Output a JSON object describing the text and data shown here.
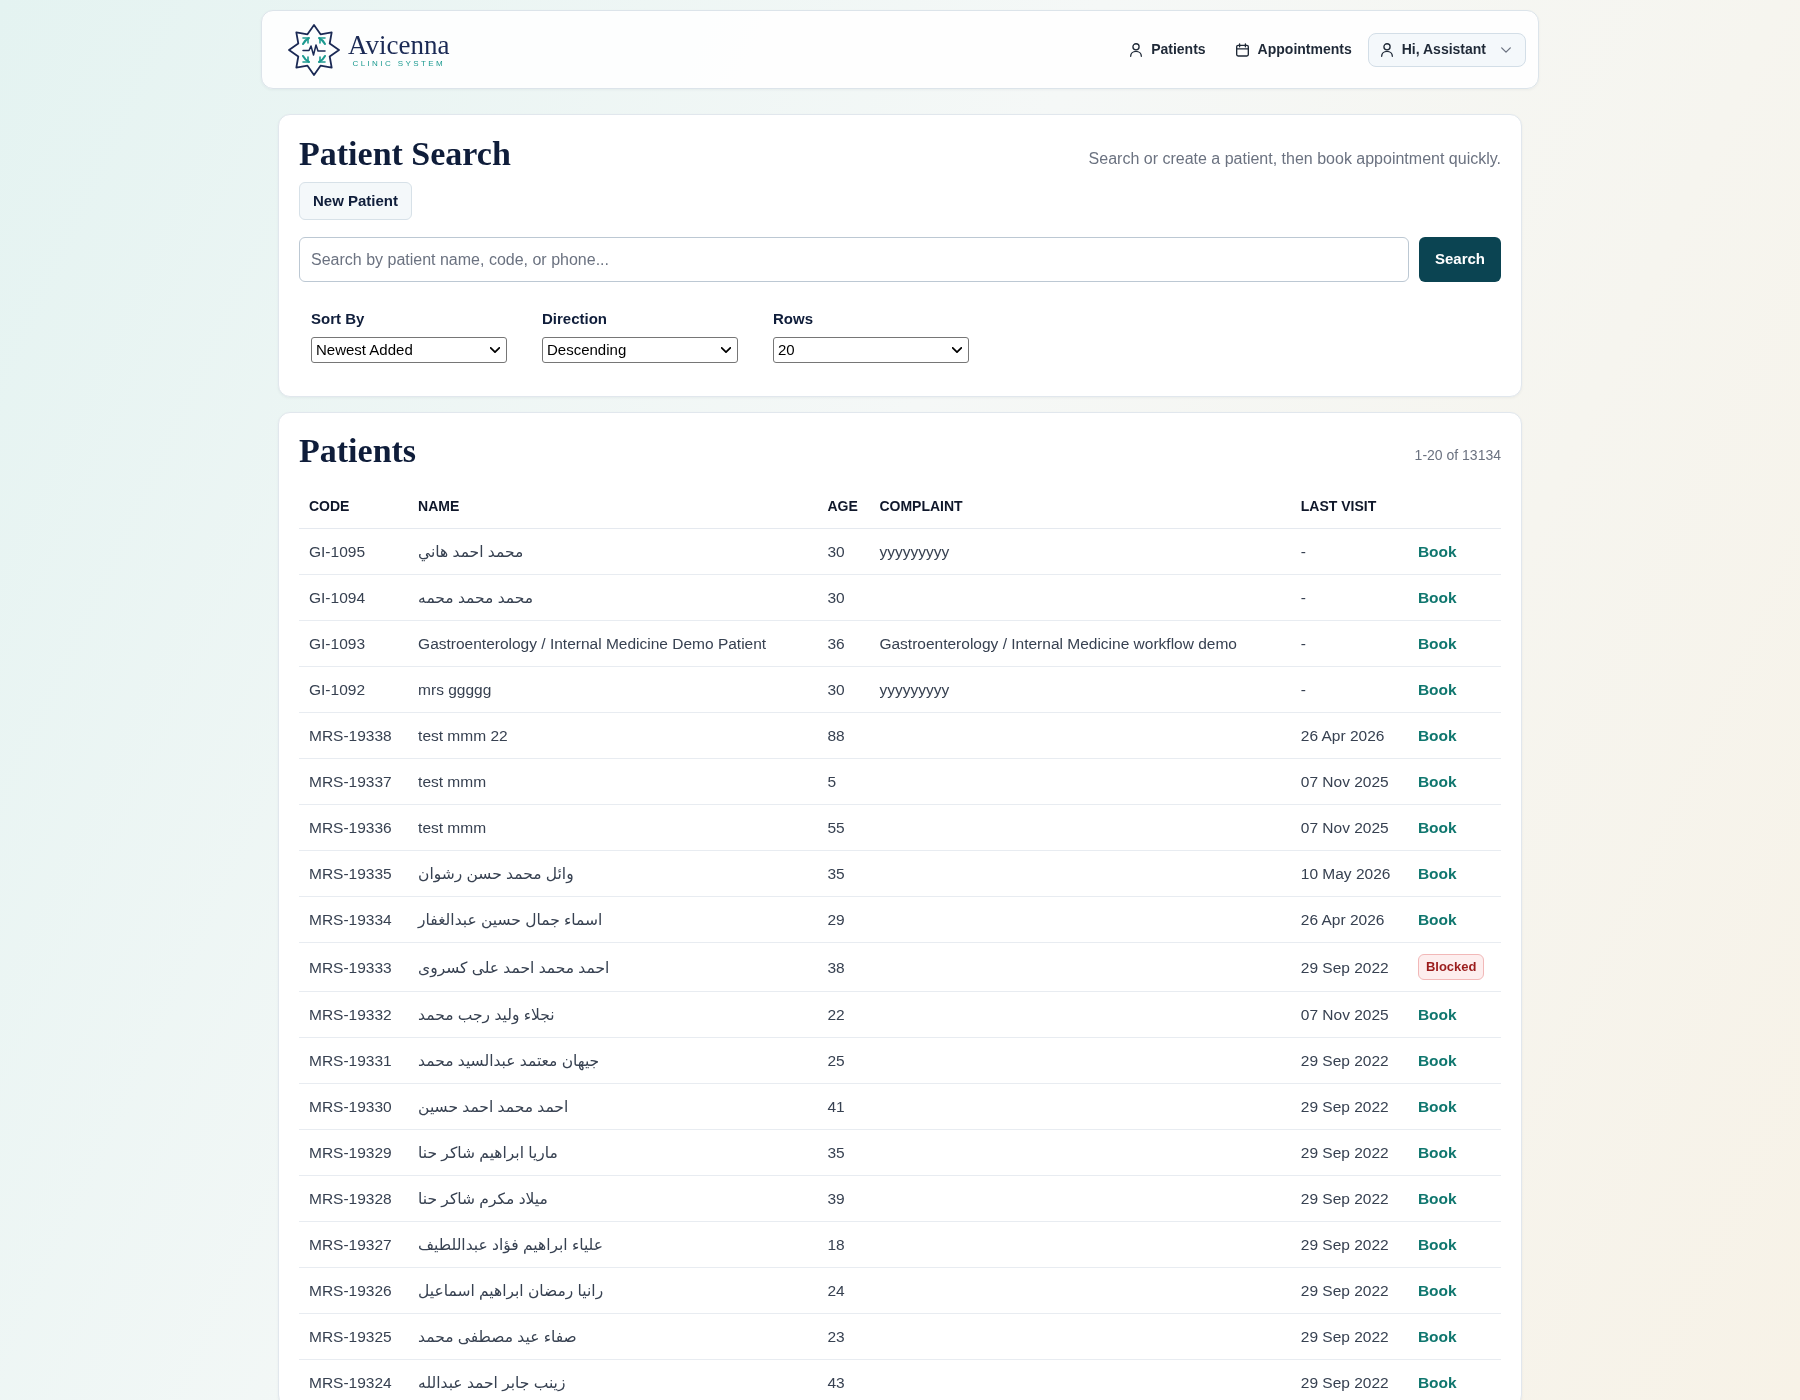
{
  "header": {
    "brand": {
      "name": "Avicenna",
      "tagline": "CLINIC SYSTEM"
    },
    "nav": [
      {
        "label": "Patients"
      },
      {
        "label": "Appointments"
      }
    ],
    "user_menu": {
      "label": "Hi, Assistant"
    }
  },
  "search_panel": {
    "title": "Patient Search",
    "subtitle": "Search or create a patient, then book appointment quickly.",
    "new_button": "New Patient",
    "search": {
      "placeholder": "Search by patient name, code, or phone..."
    },
    "search_button": "Search",
    "filters": [
      {
        "label": "Sort By",
        "value": "Newest Added"
      },
      {
        "label": "Direction",
        "value": "Descending"
      },
      {
        "label": "Rows",
        "value": "20"
      }
    ]
  },
  "patients": {
    "title": "Patients",
    "count": "1-20 of 13134",
    "table": {
      "columns": [
        "CODE",
        "NAME",
        "AGE",
        "COMPLAINT",
        "LAST VISIT"
      ],
      "rows": [
        {
          "code": "GI-1095",
          "name": "محمد احمد هاني",
          "age": "30",
          "complaint": "yyyyyyyyy",
          "last_visit": "-",
          "action": {
            "kind": "book",
            "label": "Book"
          }
        },
        {
          "code": "GI-1094",
          "name": "محمد محمد محمه",
          "age": "30",
          "last_visit": "-",
          "action": {
            "kind": "book",
            "label": "Book"
          }
        },
        {
          "code": "GI-1093",
          "name": "Gastroenterology / Internal Medicine Demo Patient",
          "age": "36",
          "complaint": "Gastroenterology / Internal Medicine workflow demo",
          "last_visit": "-",
          "action": {
            "kind": "book",
            "label": "Book"
          }
        },
        {
          "code": "GI-1092",
          "name": "mrs ggggg",
          "age": "30",
          "complaint": "yyyyyyyyy",
          "last_visit": "-",
          "action": {
            "kind": "book",
            "label": "Book"
          }
        },
        {
          "code": "MRS-19338",
          "name": "test mmm 22",
          "age": "88",
          "last_visit": "26 Apr 2026",
          "action": {
            "kind": "book",
            "label": "Book"
          }
        },
        {
          "code": "MRS-19337",
          "name": "test mmm",
          "age": "5",
          "last_visit": "07 Nov 2025",
          "action": {
            "kind": "book",
            "label": "Book"
          }
        },
        {
          "code": "MRS-19336",
          "name": "test mmm",
          "age": "55",
          "last_visit": "07 Nov 2025",
          "action": {
            "kind": "book",
            "label": "Book"
          }
        },
        {
          "code": "MRS-19335",
          "name": "وائل محمد حسن رشوان",
          "age": "35",
          "last_visit": "10 May 2026",
          "action": {
            "kind": "book",
            "label": "Book"
          }
        },
        {
          "code": "MRS-19334",
          "name": "اسماء جمال حسين عبدالغفار",
          "age": "29",
          "last_visit": "26 Apr 2026",
          "action": {
            "kind": "book",
            "label": "Book"
          }
        },
        {
          "code": "MRS-19333",
          "name": "احمد محمد احمد على كسروى",
          "age": "38",
          "last_visit": "29 Sep 2022",
          "action": {
            "kind": "blocked",
            "label": "Blocked"
          }
        },
        {
          "code": "MRS-19332",
          "name": "نجلاء وليد رجب محمد",
          "age": "22",
          "last_visit": "07 Nov 2025",
          "action": {
            "kind": "book",
            "label": "Book"
          }
        },
        {
          "code": "MRS-19331",
          "name": "جيهان معتمد عبدالسيد محمد",
          "age": "25",
          "last_visit": "29 Sep 2022",
          "action": {
            "kind": "book",
            "label": "Book"
          }
        },
        {
          "code": "MRS-19330",
          "name": "احمد محمد احمد حسين",
          "age": "41",
          "last_visit": "29 Sep 2022",
          "action": {
            "kind": "book",
            "label": "Book"
          }
        },
        {
          "code": "MRS-19329",
          "name": "ماريا ابراهيم شاكر حنا",
          "age": "35",
          "last_visit": "29 Sep 2022",
          "action": {
            "kind": "book",
            "label": "Book"
          }
        },
        {
          "code": "MRS-19328",
          "name": "ميلاد مكرم شاكر حنا",
          "age": "39",
          "last_visit": "29 Sep 2022",
          "action": {
            "kind": "book",
            "label": "Book"
          }
        },
        {
          "code": "MRS-19327",
          "name": "علياء ابراهيم فؤاد عبداللطيف",
          "age": "18",
          "last_visit": "29 Sep 2022",
          "action": {
            "kind": "book",
            "label": "Book"
          }
        },
        {
          "code": "MRS-19326",
          "name": "رانيا رمضان ابراهيم اسماعيل",
          "age": "24",
          "last_visit": "29 Sep 2022",
          "action": {
            "kind": "book",
            "label": "Book"
          }
        },
        {
          "code": "MRS-19325",
          "name": "صفاء عيد مصطفى محمد",
          "age": "23",
          "last_visit": "29 Sep 2022",
          "action": {
            "kind": "book",
            "label": "Book"
          }
        },
        {
          "code": "MRS-19324",
          "name": "زينب جابر احمد عبدالله",
          "age": "43",
          "last_visit": "29 Sep 2022",
          "action": {
            "kind": "book",
            "label": "Book"
          }
        }
      ]
    }
  }
}
